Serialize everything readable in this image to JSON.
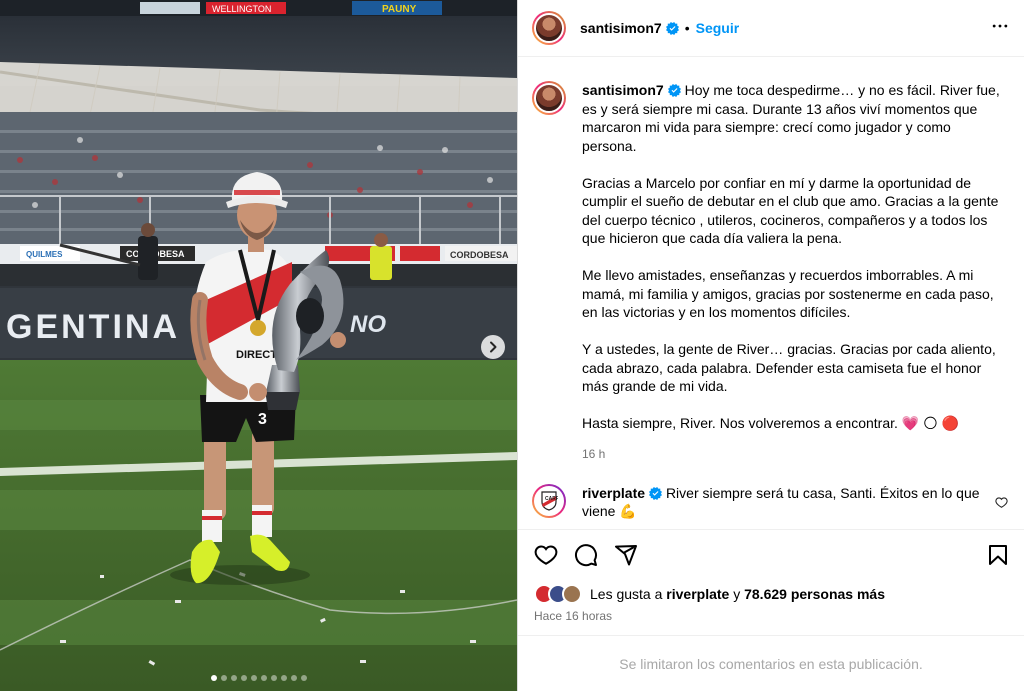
{
  "post": {
    "author": "santisimon7",
    "follow_label": "Seguir",
    "separator": "•"
  },
  "caption": {
    "author": "santisimon7",
    "paragraphs": [
      "Hoy me toca despedirme… y no es fácil. River fue, es y será siempre mi casa. Durante 13 años viví momentos que marcaron mi vida para siempre: crecí como jugador y como persona.",
      "Gracias a Marcelo por confiar en mí y darme la oportunidad de cumplir el sueño de debutar en el club que amo. Gracias a la gente del cuerpo técnico , utileros, cocineros, compañeros y a todos los que hicieron que cada día valiera la pena.",
      "Me llevo amistades, enseñanzas y recuerdos imborrables. A mi mamá, mi familia y amigos, gracias por sostenerme en cada paso, en las victorias y en los momentos difíciles.",
      "Y a ustedes, la gente de River… gracias. Gracias por cada aliento, cada abrazo, cada palabra. Defender esta camiseta fue el honor más grande de mi vida.",
      "Hasta siempre, River. Nos volveremos a encontrar. 💗 🌕 🔴"
    ],
    "time": "16 h"
  },
  "comment": {
    "author": "riverplate",
    "text": "River siempre será tu casa, Santi. Éxitos en lo que viene 💪"
  },
  "likes": {
    "prefix": "Les gusta a",
    "user": "riverplate",
    "joiner": "y",
    "count": "78.629 personas más"
  },
  "posted_ago": "Hace 16 horas",
  "comments_limited": "Se limitaron los comentarios en esta publicación.",
  "photo": {
    "banner_text": "GENTINA",
    "banner_suffix": "NO",
    "board_left": "CORDOBESA",
    "board_right": "CORDOBESA",
    "jersey_sponsor": "DIRECTV",
    "top_ad_1": "WELLINGTON",
    "top_ad_2": "PAUNY",
    "slide_count": 10,
    "active_slide": 0
  },
  "colors": {
    "accent": "#0095f6",
    "verified": "#0095f6",
    "muted": "#737373"
  }
}
